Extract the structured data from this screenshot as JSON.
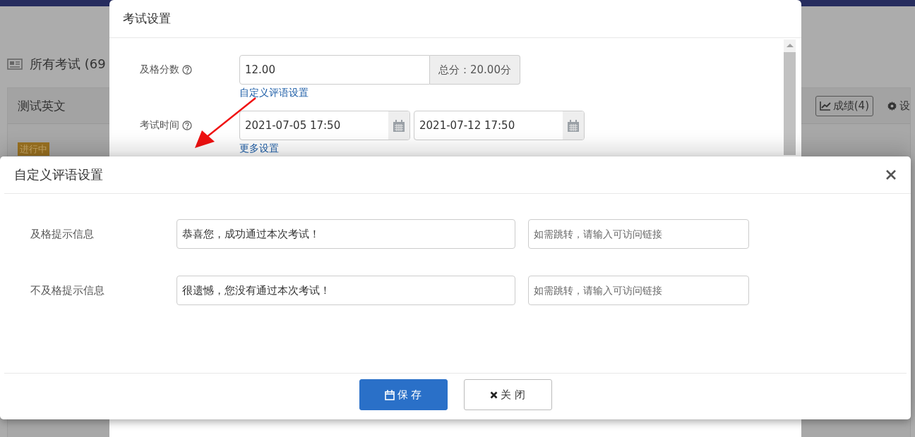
{
  "background": {
    "title": "所有考试 (69",
    "card_title": "测试英文",
    "status_badge": "进行中",
    "scores_button": "成绩(4)",
    "settings_button": "设"
  },
  "exam_settings": {
    "title": "考试设置",
    "pass_score": {
      "label": "及格分数",
      "value": "12.00",
      "total": "总分：20.00分",
      "link": "自定义评语设置"
    },
    "exam_time": {
      "label": "考试时间",
      "start": "2021-07-05 17:50",
      "end": "2021-07-12 17:50",
      "link": "更多设置"
    }
  },
  "comment_dialog": {
    "title": "自定义评语设置",
    "rows": [
      {
        "label": "及格提示信息",
        "message": "恭喜您，成功通过本次考试！",
        "link_placeholder": "如需跳转，请输入可访问链接"
      },
      {
        "label": "不及格提示信息",
        "message": "很遗憾，您没有通过本次考试！",
        "link_placeholder": "如需跳转，请输入可访问链接"
      }
    ],
    "buttons": [
      {
        "kind": "primary",
        "label": "保 存"
      },
      {
        "kind": "default",
        "label": "关 闭"
      }
    ]
  }
}
